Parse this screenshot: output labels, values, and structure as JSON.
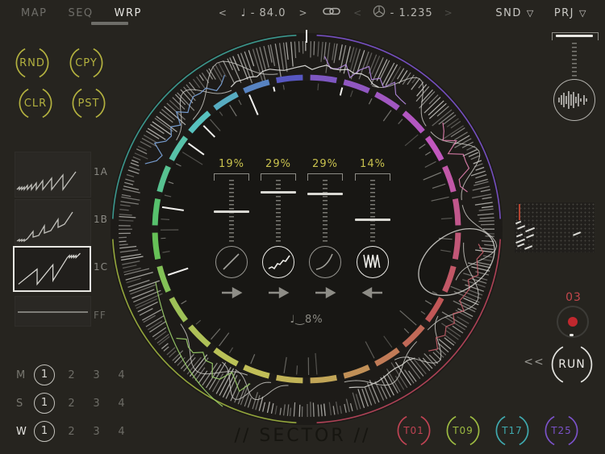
{
  "topbar": {
    "tabs": [
      {
        "label": "MAP",
        "active": false
      },
      {
        "label": "SEQ",
        "active": false
      },
      {
        "label": "WRP",
        "active": true
      }
    ],
    "tempo": {
      "prev": "<",
      "display": "♩ - 84.0",
      "next": ">"
    },
    "ratio": {
      "prev": "<",
      "display": "- 1.235",
      "next": ">"
    },
    "menus": [
      {
        "label": "SND",
        "chevron": "▽"
      },
      {
        "label": "PRJ",
        "chevron": "▽"
      }
    ]
  },
  "accent_yellow": "#b3b13f",
  "edit_buttons": [
    {
      "label": "RND"
    },
    {
      "label": "CPY"
    },
    {
      "label": "CLR"
    },
    {
      "label": "PST"
    }
  ],
  "wave_slots": [
    {
      "label": "1A",
      "selected": false
    },
    {
      "label": "1B",
      "selected": false
    },
    {
      "label": "1C",
      "selected": true
    },
    {
      "label": "FF",
      "selected": false
    }
  ],
  "pattern_matrix": {
    "rows": [
      {
        "label": "M",
        "options": [
          "1",
          "2",
          "3",
          "4"
        ],
        "selected": "1"
      },
      {
        "label": "S",
        "options": [
          "1",
          "2",
          "3",
          "4"
        ],
        "selected": "1"
      },
      {
        "label": "W",
        "options": [
          "1",
          "2",
          "3",
          "4"
        ],
        "selected": "1"
      }
    ]
  },
  "center": {
    "sliders": [
      {
        "value": "19%",
        "frac": 0.48
      },
      {
        "value": "29%",
        "frac": 0.185
      },
      {
        "value": "29%",
        "frac": 0.21
      },
      {
        "value": "14%",
        "frac": 0.6
      }
    ],
    "shapes": [
      {
        "name": "linear-ramp",
        "selected": false
      },
      {
        "name": "random-walk",
        "selected": true
      },
      {
        "name": "exp-curve",
        "selected": false
      },
      {
        "name": "triangle-dense",
        "selected": true
      }
    ],
    "directions": [
      "right",
      "right",
      "right",
      "left"
    ],
    "swing_label": "♩‿8%"
  },
  "ring": {
    "segment_hues": [
      262,
      272,
      282,
      292,
      302,
      315,
      330,
      342,
      352,
      0,
      10,
      20,
      32,
      44,
      52,
      58,
      64,
      70,
      80,
      95,
      112,
      132,
      152,
      166,
      178,
      192,
      215,
      240
    ],
    "outer_arcs": [
      {
        "color": "#7a52c8",
        "from": 3,
        "to": 87
      },
      {
        "color": "#b5455a",
        "from": 93,
        "to": 177
      },
      {
        "color": "#9aae3e",
        "from": 183,
        "to": 267
      },
      {
        "color": "#3d9e94",
        "from": 273,
        "to": 357
      }
    ]
  },
  "right_panel": {
    "record_count": "03",
    "rewind_label": "<<",
    "run_label": "RUN"
  },
  "track_buttons": [
    {
      "label": "T01",
      "color": "#bf4353"
    },
    {
      "label": "T09",
      "color": "#9cba41"
    },
    {
      "label": "T17",
      "color": "#3fa9ae"
    },
    {
      "label": "T25",
      "color": "#7a52c8"
    }
  ],
  "watermark": "// SECTOR //"
}
